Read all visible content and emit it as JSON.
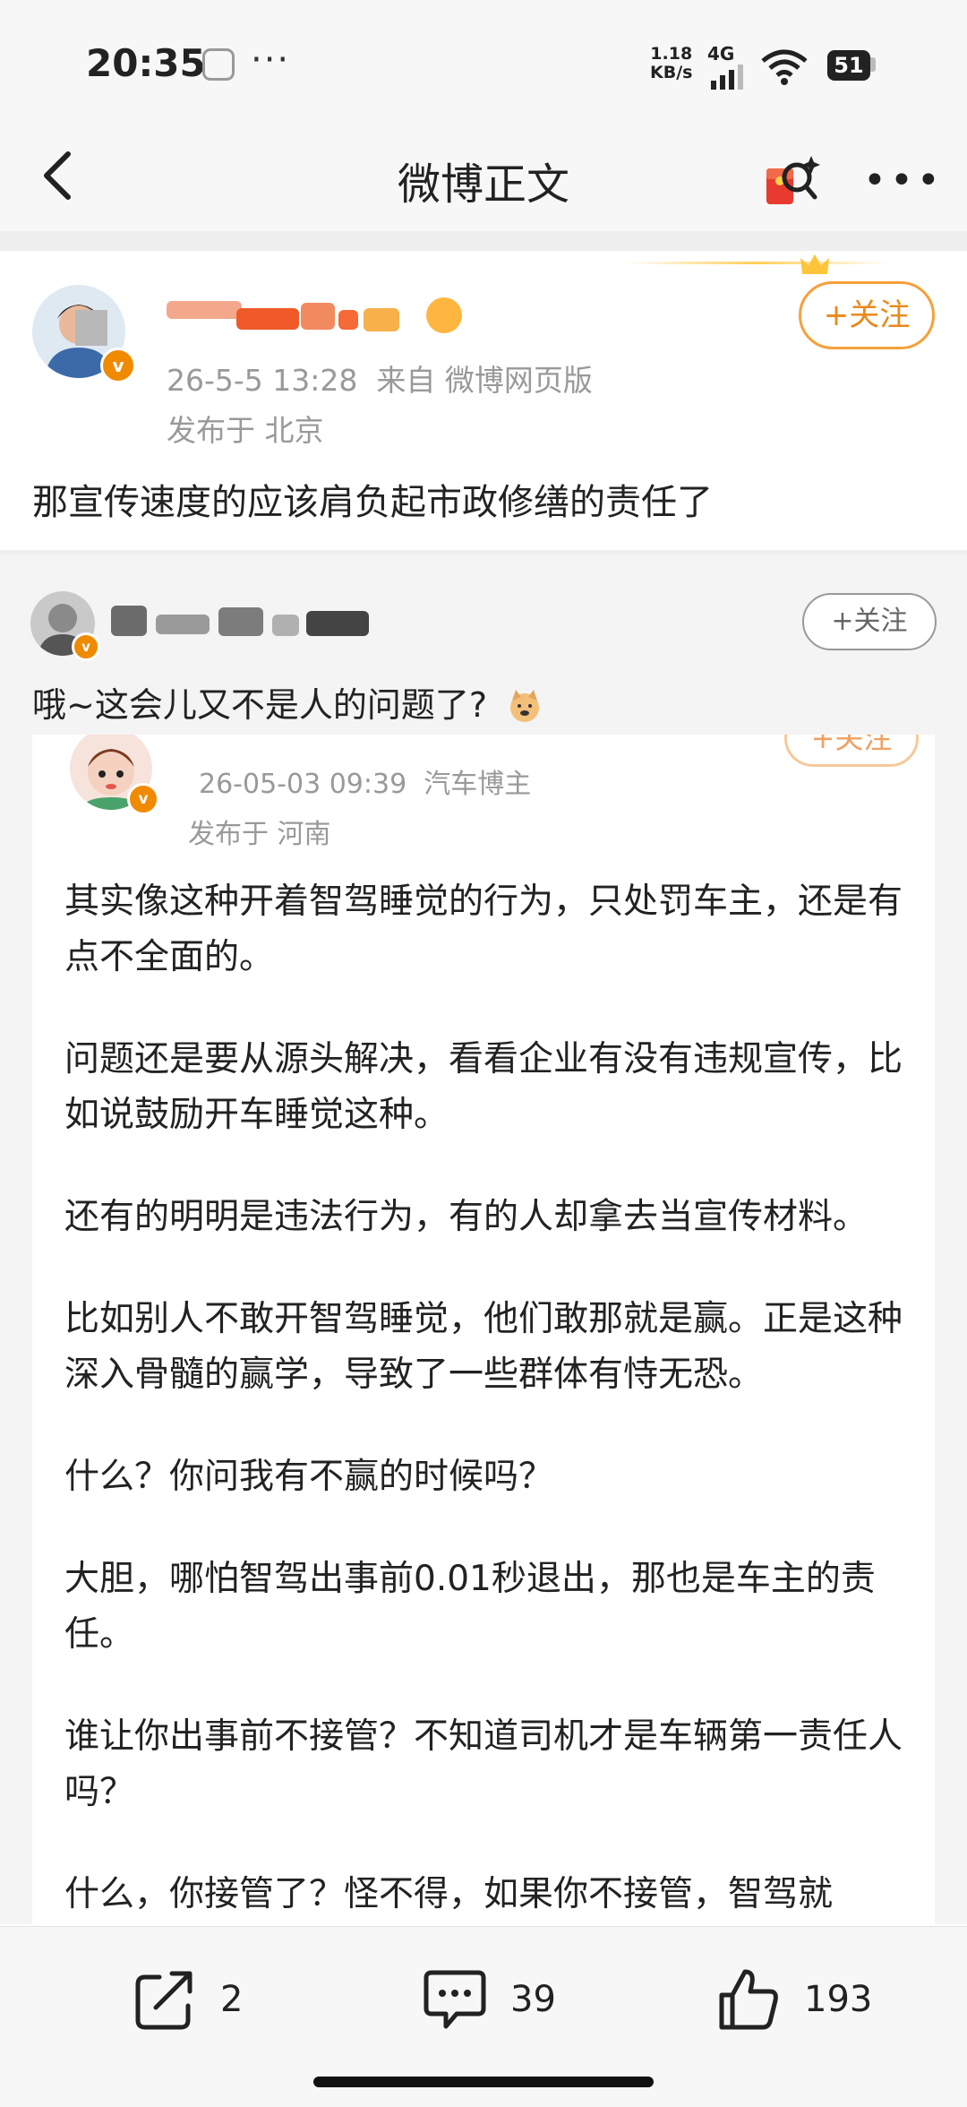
{
  "status_bar": {
    "time": "20:35",
    "more": "···",
    "net_speed": "1.18",
    "net_unit": "KB/s",
    "network": "4G",
    "battery": "51"
  },
  "nav": {
    "title": "微博正文",
    "more": "•••"
  },
  "post": {
    "timestamp": "26-5-5 13:28",
    "source": "来自 微博网页版",
    "location": "发布于 北京",
    "text": "那宣传速度的应该肩负起市政修缮的责任了",
    "follow_label": "+关注"
  },
  "repost_comment": {
    "follow_label": "+关注",
    "text": "哦~这会儿又不是人的问题了?"
  },
  "quoted": {
    "timestamp": "26-05-03 09:39",
    "source": "汽车博主",
    "location": "发布于 河南",
    "follow_label": "+关注",
    "paragraphs": [
      "其实像这种开着智驾睡觉的行为，只处罚车主，还是有点不全面的。",
      "问题还是要从源头解决，看看企业有没有违规宣传，比如说鼓励开车睡觉这种。",
      "还有的明明是违法行为，有的人却拿去当宣传材料。",
      "比如别人不敢开智驾睡觉，他们敢那就是赢。正是这种深入骨髓的赢学，导致了一些群体有恃无恐。",
      "什么？你问我有不赢的时候吗？",
      "大胆，哪怕智驾出事前0.01秒退出，那也是车主的责任。",
      "谁让你出事前不接管？不知道司机才是车辆第一责任人吗？",
      "什么，你接管了？怪不得，如果你不接管，智驾就"
    ]
  },
  "actions": {
    "share_count": "2",
    "comment_count": "39",
    "like_count": "193"
  }
}
